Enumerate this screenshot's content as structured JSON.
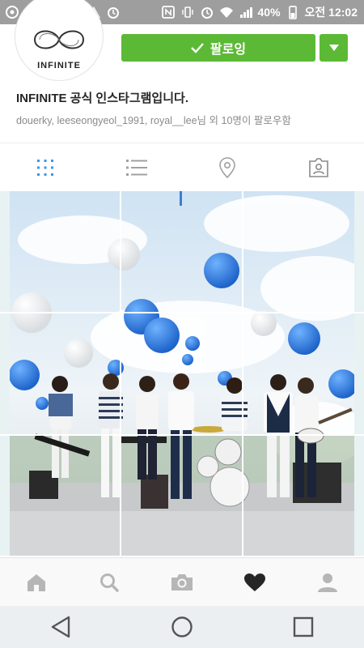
{
  "status_bar": {
    "battery_text": "40%",
    "time": "오전 12:02",
    "app_badge": "piki"
  },
  "profile": {
    "avatar_logo_text": "INFINITE",
    "follow_button_label": "팔로잉",
    "bio_name": "INFINITE 공식 인스타그램입니다.",
    "followed_by": "douerky, leeseongyeol_1991, royal__lee님 외 10명이 팔로우함"
  },
  "tabs": [
    {
      "name": "grid",
      "active": true
    },
    {
      "name": "list",
      "active": false
    },
    {
      "name": "location",
      "active": false
    },
    {
      "name": "tagged",
      "active": false
    }
  ],
  "bottom_nav": [
    "home",
    "search",
    "camera",
    "activity",
    "profile"
  ],
  "colors": {
    "follow_green": "#5cb935",
    "active_tab_blue": "#3897f0",
    "status_bar": "#9e9e9e",
    "balloon_blue": "#2a7fd8"
  }
}
